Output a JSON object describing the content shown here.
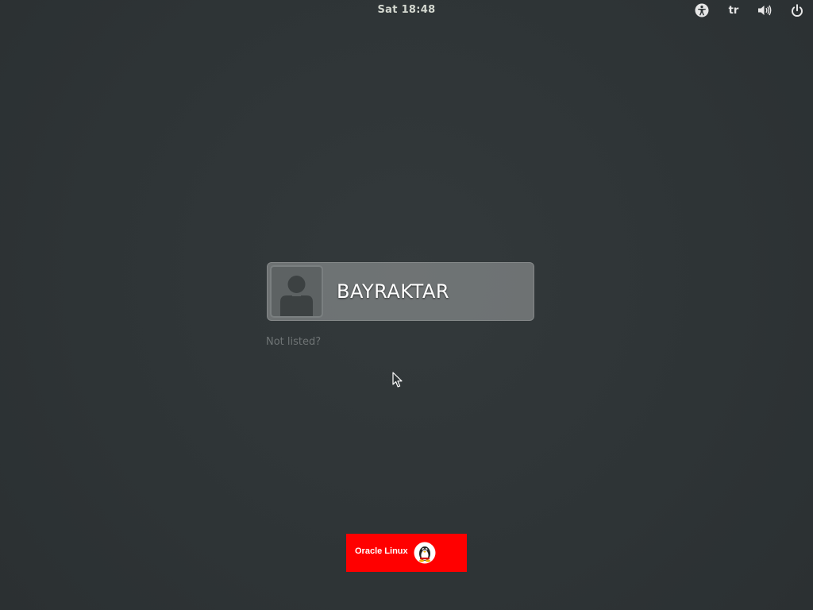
{
  "top_bar": {
    "clock": "Sat 18:48",
    "keyboard_layout": "tr",
    "icons": [
      "accessibility-icon",
      "volume-icon",
      "power-icon"
    ]
  },
  "user_list": {
    "users": [
      {
        "name": "BAYRAKTAR",
        "avatar": "default-user-avatar-icon"
      }
    ],
    "not_listed_label": "Not listed?"
  },
  "branding": {
    "logo_text": "Oracle Linux",
    "logo_icon": "tux-penguin-icon",
    "logo_color": "#ff0000"
  },
  "colors": {
    "background": "#2e3436",
    "user_row_background": "#8a8d8d",
    "muted_text": "#6f7475"
  }
}
